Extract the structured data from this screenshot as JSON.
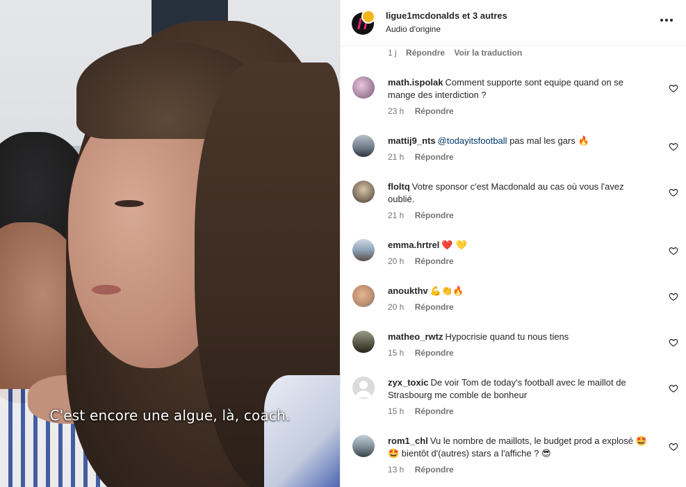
{
  "video": {
    "subtitle": "C'est encore une algue, là, coach."
  },
  "header": {
    "account": "ligue1mcdonalds",
    "others": "et 3 autres",
    "audio": "Audio d'origine",
    "avatar_icon": "ligue1-logo-icon",
    "more_icon": "more-options-icon"
  },
  "top_meta": {
    "time": "1 j",
    "reply": "Répondre",
    "translate": "Voir la traduction"
  },
  "comments": [
    {
      "user": "math.ispolak",
      "text": "Comment supporte sont equipe quand on se mange des interdiction ?",
      "time": "23 h",
      "reply": "Répondre",
      "avatar_color": "#b38ca8"
    },
    {
      "user": "mattij9_nts",
      "mention": "@todayitsfootball",
      "text": "pas mal les gars 🔥",
      "time": "21 h",
      "reply": "Répondre",
      "avatar_color": "#6b7886"
    },
    {
      "user": "floltq",
      "text": "Votre sponsor c'est Macdonald au cas où vous l'avez oublié.",
      "time": "21 h",
      "reply": "Répondre",
      "avatar_color": "#8a7a66"
    },
    {
      "user": "emma.hrtrel",
      "text": "❤️ 💛",
      "time": "20 h",
      "reply": "Répondre",
      "avatar_color": "#8fa3b8"
    },
    {
      "user": "anoukthv",
      "text": "💪👏🔥",
      "time": "20 h",
      "reply": "Répondre",
      "avatar_color": "#c09070"
    },
    {
      "user": "matheo_rwtz",
      "text": "Hypocrisie quand tu nous tiens",
      "time": "15 h",
      "reply": "Répondre",
      "avatar_color": "#5a5a48"
    },
    {
      "user": "zyx_toxic",
      "text": "De voir Tom de today's football avec le maillot de Strasbourg me comble de bonheur",
      "time": "15 h",
      "reply": "Répondre",
      "avatar_color": "#dbdbdb"
    },
    {
      "user": "rom1_chl",
      "text": "Vu le nombre de maillots, le budget prod a explosé 🤩🤩 bientôt d'(autres) stars a l'affiche ? 😎",
      "time": "13 h",
      "reply": "Répondre",
      "avatar_color": "#7e8c96"
    }
  ],
  "icons": {
    "like": "heart-outline-icon"
  }
}
